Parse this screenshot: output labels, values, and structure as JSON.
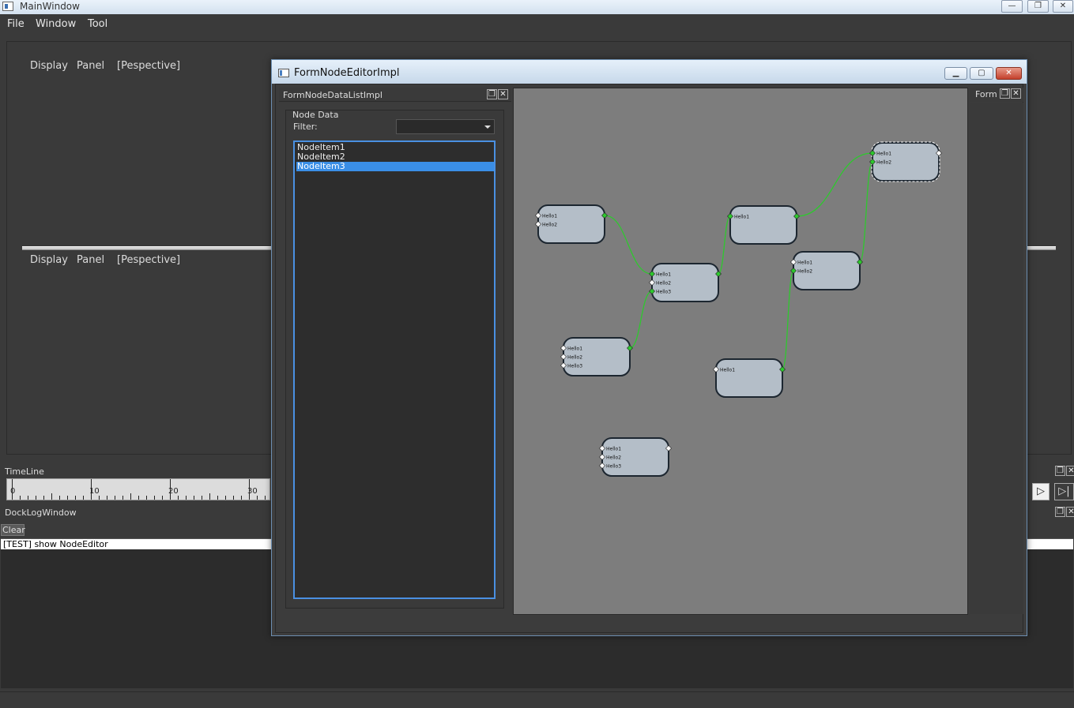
{
  "main_window": {
    "title": "MainWindow",
    "min_glyph": "—",
    "max_glyph": "❐",
    "close_glyph": "✕"
  },
  "menubar": {
    "items": [
      "File",
      "Window",
      "Tool"
    ]
  },
  "views": {
    "top": {
      "items": [
        "Display",
        "Panel",
        "[Pespective]"
      ]
    },
    "bottom": {
      "items": [
        "Display",
        "Panel",
        "[Pespective]"
      ]
    }
  },
  "timeline": {
    "title": "TimeLine",
    "tick_labels": [
      "0",
      "10",
      "20",
      "30"
    ],
    "float_glyph": "❐",
    "close_glyph": "✕",
    "play_glyph": "▷",
    "step_glyph": "▷|"
  },
  "log": {
    "title": "DockLogWindow",
    "clear_label": "Clear",
    "lines": [
      "[TEST] show NodeEditor"
    ],
    "float_glyph": "❐",
    "close_glyph": "✕"
  },
  "editor": {
    "title": "FormNodeEditorImpl",
    "min_glyph": "▁",
    "max_glyph": "▢",
    "close_glyph": "✕",
    "list_panel": {
      "title": "FormNodeDataListImpl",
      "group_title": "Node Data",
      "filter_label": "Filter:",
      "filter_value": "",
      "items": [
        "NodeItem1",
        "NodeItem2",
        "NodeItem3"
      ],
      "selected_index": 2,
      "float_glyph": "❐",
      "close_glyph": "✕"
    },
    "right_panel": {
      "title": "Form",
      "float_glyph": "❐",
      "close_glyph": "✕"
    }
  },
  "graph": {
    "colors": {
      "background": "#7d7d7d",
      "node_fill": "#b4bec8",
      "node_border": "#1c2630",
      "link": "#2ec82e"
    },
    "nodes": [
      {
        "id": "n1",
        "ports": [
          "Hello1",
          "Hello2"
        ]
      },
      {
        "id": "n2",
        "ports": [
          "Hello1",
          "Hello2",
          "Hello3"
        ]
      },
      {
        "id": "n3",
        "ports": [
          "Hello1",
          "Hello2",
          "Hello3"
        ]
      },
      {
        "id": "n4",
        "ports": [
          "Hello1"
        ]
      },
      {
        "id": "n5",
        "ports": [
          "Hello1",
          "Hello2"
        ]
      },
      {
        "id": "n6",
        "ports": [
          "Hello1",
          "Hello2"
        ],
        "selected": true
      },
      {
        "id": "n7",
        "ports": [
          "Hello1"
        ]
      },
      {
        "id": "n8",
        "ports": [
          "Hello1",
          "Hello2",
          "Hello3"
        ]
      }
    ],
    "links": [
      {
        "from": "n1",
        "to": "n2",
        "to_port": 0
      },
      {
        "from": "n3",
        "to": "n2",
        "to_port": 2
      },
      {
        "from": "n2",
        "to": "n4",
        "to_port": 0
      },
      {
        "from": "n4",
        "to": "n6",
        "to_port": 0
      },
      {
        "from": "n5",
        "to": "n6",
        "to_port": 1
      },
      {
        "from": "n7",
        "to": "n5",
        "to_port": 1
      }
    ]
  }
}
